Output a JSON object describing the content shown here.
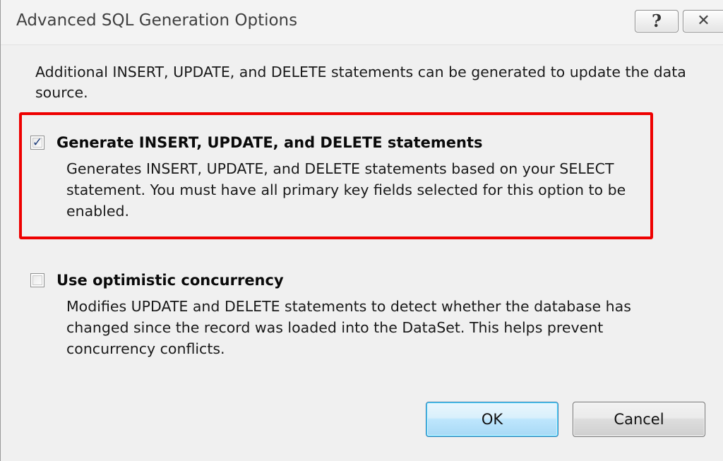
{
  "window": {
    "title": "Advanced SQL Generation Options",
    "help_glyph": "?",
    "close_glyph": "✕"
  },
  "intro_text": "Additional INSERT, UPDATE, and DELETE statements can be generated to update the data source.",
  "options": [
    {
      "label": "Generate INSERT, UPDATE, and DELETE statements",
      "checked": true,
      "description": "Generates INSERT, UPDATE, and DELETE statements based on your SELECT statement. You must have all primary key fields selected for this option to be enabled."
    },
    {
      "label": "Use optimistic concurrency",
      "checked": false,
      "description": "Modifies UPDATE and DELETE statements to detect whether the database has changed since the record was loaded into the DataSet. This helps prevent concurrency conflicts."
    }
  ],
  "buttons": {
    "ok_label": "OK",
    "cancel_label": "Cancel"
  },
  "colors": {
    "highlight_border": "#ee0000",
    "dialog_background": "#f0f0f0"
  },
  "icons": {
    "help": "question-mark-icon",
    "close": "close-icon",
    "check": "checkmark-icon"
  }
}
